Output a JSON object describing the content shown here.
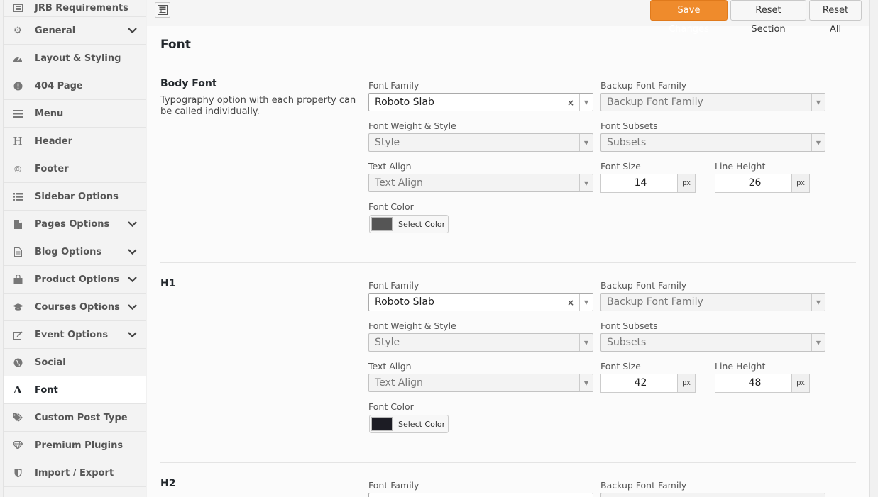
{
  "sidebar": {
    "items": [
      {
        "label": "JRB Requirements",
        "icon": "list-alt-icon",
        "chevron": false,
        "active": false
      },
      {
        "label": "General",
        "icon": "cogs-icon",
        "chevron": true,
        "active": false
      },
      {
        "label": "Layout & Styling",
        "icon": "dashboard-icon",
        "chevron": false,
        "active": false
      },
      {
        "label": "404 Page",
        "icon": "exclamation-circle-icon",
        "chevron": false,
        "active": false
      },
      {
        "label": "Menu",
        "icon": "bars-icon",
        "chevron": false,
        "active": false
      },
      {
        "label": "Header",
        "icon": "header-icon",
        "chevron": false,
        "active": false
      },
      {
        "label": "Footer",
        "icon": "copyright-icon",
        "chevron": false,
        "active": false
      },
      {
        "label": "Sidebar Options",
        "icon": "list-icon",
        "chevron": false,
        "active": false
      },
      {
        "label": "Pages Options",
        "icon": "file-icon",
        "chevron": true,
        "active": false
      },
      {
        "label": "Blog Options",
        "icon": "file-text-icon",
        "chevron": true,
        "active": false
      },
      {
        "label": "Product Options",
        "icon": "shopping-bag-icon",
        "chevron": true,
        "active": false
      },
      {
        "label": "Courses Options",
        "icon": "graduation-cap-icon",
        "chevron": true,
        "active": false
      },
      {
        "label": "Event Options",
        "icon": "edit-icon",
        "chevron": true,
        "active": false
      },
      {
        "label": "Social",
        "icon": "globe-icon",
        "chevron": false,
        "active": false
      },
      {
        "label": "Font",
        "icon": "font-icon",
        "chevron": false,
        "active": true
      },
      {
        "label": "Custom Post Type",
        "icon": "tags-icon",
        "chevron": false,
        "active": false
      },
      {
        "label": "Premium Plugins",
        "icon": "diamond-icon",
        "chevron": false,
        "active": false
      },
      {
        "label": "Import / Export",
        "icon": "shield-icon",
        "chevron": false,
        "active": false
      }
    ]
  },
  "toolbar": {
    "save_label": "Save Changes",
    "reset_section_label": "Reset Section",
    "reset_all_label": "Reset All"
  },
  "section": {
    "title": "Font"
  },
  "labels": {
    "font_family": "Font Family",
    "backup_font_family": "Backup Font Family",
    "font_weight_style": "Font Weight & Style",
    "font_subsets": "Font Subsets",
    "text_align": "Text Align",
    "font_size": "Font Size",
    "line_height": "Line Height",
    "font_color": "Font Color",
    "select_color": "Select Color",
    "px": "px"
  },
  "placeholders": {
    "backup_font_family": "Backup Font Family",
    "style": "Style",
    "subsets": "Subsets",
    "text_align": "Text Align"
  },
  "groups": [
    {
      "title": "Body Font",
      "desc": "Typography option with each property can be called individually.",
      "font_family": "Roboto Slab",
      "font_size": "14",
      "line_height": "26",
      "color": "#555555"
    },
    {
      "title": "H1",
      "desc": "",
      "font_family": "Roboto Slab",
      "font_size": "42",
      "line_height": "48",
      "color": "#1c1c24"
    },
    {
      "title": "H2"
    }
  ],
  "colors": {
    "accent": "#ef8b2c"
  }
}
